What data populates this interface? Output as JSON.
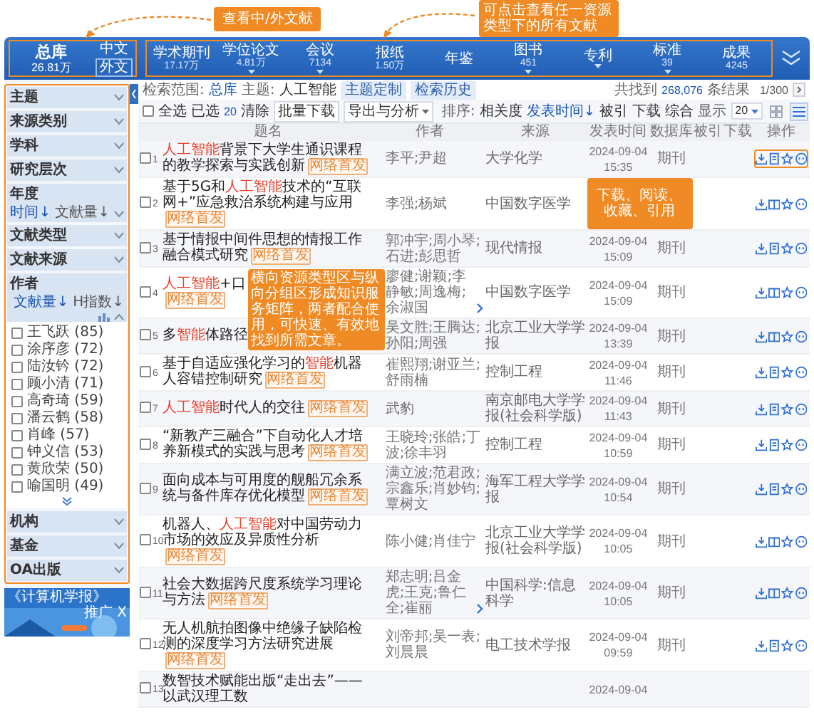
{
  "callouts": [
    {
      "text": "查看中/外文献"
    },
    {
      "text": "可点击查看任一资源类型下的所有文献"
    },
    {
      "text": "下载、阅读、收藏、引用"
    },
    {
      "text": "横向资源类型区与纵向分组区形成知识服务矩阵，两者配合使用，可快速、有效地找到所需文章。"
    }
  ],
  "library": {
    "title": "总库",
    "count": "26.81万",
    "languages": [
      {
        "label": "中文",
        "selected": false
      },
      {
        "label": "外文",
        "selected": true
      }
    ]
  },
  "resource_tabs": [
    {
      "label": "学术期刊",
      "count": "17.17万",
      "dropdown": false
    },
    {
      "label": "学位论文",
      "count": "4.81万",
      "dropdown": true
    },
    {
      "label": "会议",
      "count": "7134",
      "dropdown": true
    },
    {
      "label": "报纸",
      "count": "1.50万",
      "dropdown": false
    },
    {
      "label": "年鉴",
      "dropdown": false
    },
    {
      "label": "图书",
      "count": "451",
      "dropdown": true
    },
    {
      "label": "专利",
      "dropdown": true
    },
    {
      "label": "标准",
      "count": "39",
      "dropdown": true
    },
    {
      "label": "成果",
      "count": "4245",
      "dropdown": false
    }
  ],
  "sidebar": {
    "groups": [
      {
        "label": "主题",
        "expanded": false
      },
      {
        "label": "来源类别",
        "expanded": false
      },
      {
        "label": "学科",
        "expanded": false
      },
      {
        "label": "研究层次",
        "expanded": false
      },
      {
        "label": "年度",
        "expanded": false,
        "sorts": [
          {
            "label": "时间↓",
            "selected": true
          },
          {
            "label": "文献量↓",
            "selected": false
          }
        ]
      },
      {
        "label": "文献类型",
        "expanded": false
      },
      {
        "label": "文献来源",
        "expanded": false
      },
      {
        "label": "作者",
        "expanded": true,
        "sorts": [
          {
            "label": "文献量↓",
            "selected": true
          },
          {
            "label": "H指数↓",
            "selected": false
          }
        ],
        "items": [
          {
            "label": "王飞跃 (85)",
            "checked": false
          },
          {
            "label": "涂序彦 (72)",
            "checked": false
          },
          {
            "label": "陆汝钤 (72)",
            "checked": false
          },
          {
            "label": "顾小清 (71)",
            "checked": false
          },
          {
            "label": "高奇琦 (59)",
            "checked": false
          },
          {
            "label": "潘云鹤 (58)",
            "checked": false
          },
          {
            "label": "肖峰 (57)",
            "checked": false
          },
          {
            "label": "钟义信 (53)",
            "checked": false
          },
          {
            "label": "黄欣荣 (50)",
            "checked": false
          },
          {
            "label": "喻国明 (49)",
            "checked": false
          }
        ]
      },
      {
        "label": "机构",
        "expanded": false
      },
      {
        "label": "基金",
        "expanded": false
      },
      {
        "label": "OA出版",
        "expanded": false
      }
    ],
    "ad": {
      "title": "《计算机学报》",
      "badge": "推广",
      "close": "X"
    }
  },
  "search_info": {
    "scope_label": "检索范围:",
    "scope": "总库",
    "topic_label": "主题:",
    "topic": "人工智能",
    "buttons": [
      "主题定制",
      "检索历史"
    ],
    "result_prefix": "共找到",
    "result_count": "268,076",
    "result_suffix": "条结果",
    "page": "1/300"
  },
  "toolbar": {
    "select_all": "全选",
    "select_all_checked": false,
    "selected_label": "已选",
    "selected_count": "20",
    "clear": "清除",
    "batch_download": "批量下载",
    "export": "导出与分析",
    "sort_label": "排序:",
    "sorts": [
      {
        "label": "相关度",
        "selected": false
      },
      {
        "label": "发表时间↓",
        "selected": true
      },
      {
        "label": "被引",
        "selected": false
      },
      {
        "label": "下载",
        "selected": false
      },
      {
        "label": "综合",
        "selected": false
      }
    ],
    "display_label": "显示",
    "page_size": "20",
    "views": [
      {
        "kind": "grid",
        "selected": false
      },
      {
        "kind": "list",
        "selected": true
      }
    ]
  },
  "table": {
    "columns": [
      "题名",
      "作者",
      "来源",
      "发表时间",
      "数据库",
      "被引",
      "下载",
      "操作"
    ],
    "rows": [
      {
        "num": "1",
        "checked": false,
        "title": [
          {
            "text": "人工智能",
            "hit": true
          },
          {
            "text": "背景下大学生通识课程的教学探索与实践创新",
            "hit": false
          }
        ],
        "tag": "网络首发",
        "authors": "李平;尹超",
        "authors_more": false,
        "source": "大学化学",
        "date": "2024-09-04",
        "time": "15:35",
        "database": "期刊",
        "kind": "pdf",
        "actions_highlighted": true
      },
      {
        "num": "2",
        "checked": false,
        "title": [
          {
            "text": "基于5G和",
            "hit": false
          },
          {
            "text": "人工智能",
            "hit": true
          },
          {
            "text": "技术的“互联网+”应急救治系统构建与应用",
            "hit": false
          }
        ],
        "tag": "网络首发",
        "authors": "李强;杨斌",
        "authors_more": false,
        "source": "中国数字医学",
        "kind": "book",
        "actions_highlighted": false
      },
      {
        "num": "3",
        "checked": false,
        "title": [
          {
            "text": "基于情报中间件思想的情报工作融合模式研究",
            "hit": false
          }
        ],
        "tag": "网络首发",
        "authors": "郭冲宇;周小琴;石进;彭思哲",
        "authors_more": false,
        "source": "现代情报",
        "date": "2024-09-04",
        "time": "15:09",
        "database": "期刊",
        "kind": "pdf",
        "actions_highlighted": false
      },
      {
        "num": "4",
        "checked": false,
        "title": [
          {
            "text": "人工智能",
            "hit": true
          },
          {
            "text": "+口",
            "hit": false
          }
        ],
        "tag": "网络首发",
        "authors": "廖健;谢颖;李静敏;周逸梅;余淑国",
        "authors_more": true,
        "source": "中国数字医学",
        "date": "2024-09-04",
        "time": "15:09",
        "database": "期刊",
        "kind": "book",
        "actions_highlighted": false
      },
      {
        "num": "5",
        "checked": false,
        "title": [
          {
            "text": "多",
            "hit": false
          },
          {
            "text": "智能",
            "hit": true
          },
          {
            "text": "体路径",
            "hit": false
          }
        ],
        "authors": "吴文胜;王腾达;孙阳;周强",
        "authors_more": false,
        "source": "北京工业大学学报",
        "date": "2024-09-04",
        "time": "13:39",
        "database": "期刊",
        "kind": "book",
        "actions_highlighted": false
      },
      {
        "num": "6",
        "checked": false,
        "title": [
          {
            "text": "基于自适应强化学习的",
            "hit": false
          },
          {
            "text": "智能",
            "hit": true
          },
          {
            "text": "机器人容错控制研究",
            "hit": false
          }
        ],
        "tag": "网络首发",
        "authors": "崔熙翔;谢亚兰;舒雨楠",
        "authors_more": false,
        "source": "控制工程",
        "date": "2024-09-04",
        "time": "11:46",
        "database": "期刊",
        "kind": "pdf",
        "actions_highlighted": false
      },
      {
        "num": "7",
        "checked": false,
        "title": [
          {
            "text": "人工智能",
            "hit": true
          },
          {
            "text": "时代人的交往",
            "hit": false
          }
        ],
        "tag": "网络首发",
        "authors": "武豹",
        "authors_more": false,
        "source": "南京邮电大学学报(社会科学版)",
        "date": "2024-09-04",
        "time": "11:43",
        "database": "期刊",
        "kind": "pdf",
        "actions_highlighted": false
      },
      {
        "num": "8",
        "checked": false,
        "title": [
          {
            "text": "“新教产三融合”下自动化人才培养新模式的实践与思考",
            "hit": false
          }
        ],
        "tag": "网络首发",
        "authors": "王晓玲;张皓;丁波;徐丰羽",
        "authors_more": false,
        "source": "控制工程",
        "date": "2024-09-04",
        "time": "10:59",
        "database": "期刊",
        "kind": "pdf",
        "actions_highlighted": false
      },
      {
        "num": "9",
        "checked": false,
        "title": [
          {
            "text": "面向成本与可用度的舰船冗余系统与备件库存优化模型",
            "hit": false
          }
        ],
        "tag": "网络首发",
        "authors": "满立波;范君政;宗鑫乐;肖妙钧;覃树文",
        "authors_more": false,
        "source": "海军工程大学学报",
        "date": "2024-09-04",
        "time": "10:54",
        "database": "期刊",
        "kind": "pdf",
        "actions_highlighted": false
      },
      {
        "num": "10",
        "checked": false,
        "title": [
          {
            "text": "机器人、",
            "hit": false
          },
          {
            "text": "人工智能",
            "hit": true
          },
          {
            "text": "对中国劳动力市场的效应及异质性分析",
            "hit": false
          }
        ],
        "tag": "网络首发",
        "authors": "陈小健;肖佳宁",
        "authors_more": false,
        "source": "北京工业大学学报(社会科学版)",
        "date": "2024-09-04",
        "time": "10:05",
        "database": "期刊",
        "kind": "book",
        "actions_highlighted": false
      },
      {
        "num": "11",
        "checked": false,
        "title": [
          {
            "text": "社会大数据跨尺度系统学习理论与方法",
            "hit": false
          }
        ],
        "tag": "网络首发",
        "authors": "郑志明;吕金虎;王克;鲁仁全;崔丽",
        "authors_more": true,
        "source": "中国科学:信息科学",
        "date": "2024-09-04",
        "time": "10:05",
        "database": "期刊",
        "kind": "book",
        "actions_highlighted": false
      },
      {
        "num": "12",
        "checked": false,
        "title": [
          {
            "text": "无人机航拍图像中绝缘子缺陷检测的深度学习方法研究进展",
            "hit": false
          }
        ],
        "tag": "网络首发",
        "authors": "刘帝邦;吴一表;刘晨晨",
        "authors_more": false,
        "source": "电工技术学报",
        "date": "2024-09-04",
        "time": "09:59",
        "database": "期刊",
        "kind": "pdf",
        "actions_highlighted": false
      },
      {
        "num": "13",
        "checked": false,
        "title": [
          {
            "text": "数智技术赋能出版“走出去”——以武汉理工数",
            "hit": false
          }
        ],
        "date": "2024-09-04"
      }
    ]
  }
}
